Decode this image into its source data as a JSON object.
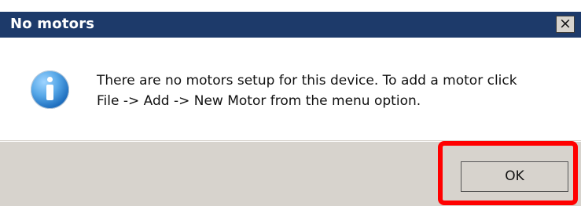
{
  "dialog": {
    "title": "No motors",
    "close_label": "×",
    "message_line1": "There are no motors setup for this device. To add a motor click",
    "message_line2": "File -> Add -> New Motor from the menu option.",
    "ok_label": "OK",
    "icon": "info-icon"
  },
  "colors": {
    "titlebar": "#1d3a6a",
    "title_text": "#ffffff",
    "content_background": "#ffffff",
    "footer_background": "#d7d3cd",
    "highlight": "#ff0000",
    "info_icon": "#1f6fbf"
  }
}
